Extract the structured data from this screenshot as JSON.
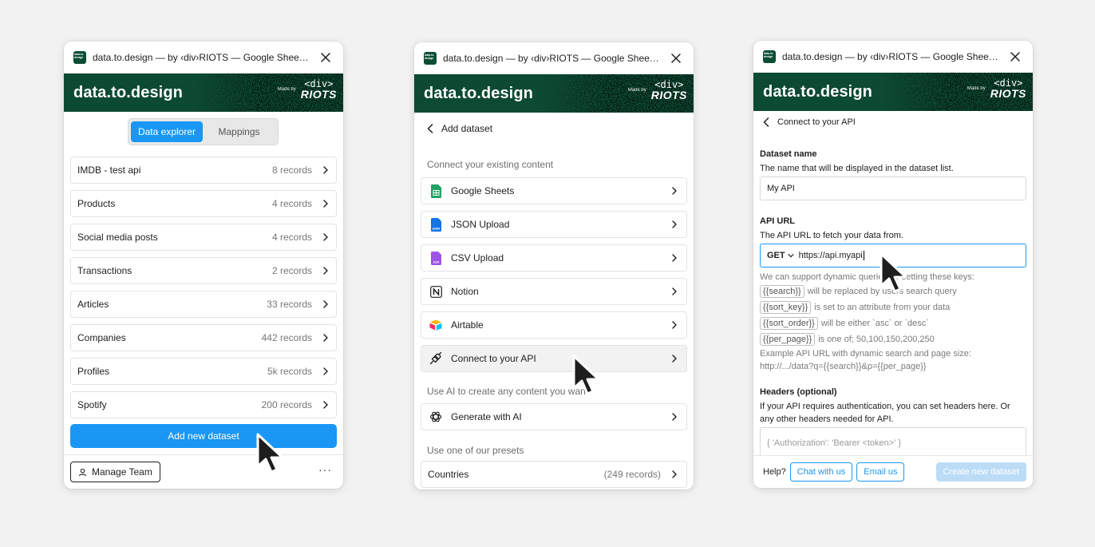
{
  "window_title": "data.to.design — by ‹div›RIOTS — Google Sheets, ...",
  "app_icon_text": "data to design",
  "brand": "data.to.design",
  "made_by_label": "Made by",
  "made_by_div": "<div>",
  "made_by_name": "RIOTS",
  "explorer": {
    "tabs": [
      "Data explorer",
      "Mappings"
    ],
    "datasets": [
      {
        "name": "IMDB - test api",
        "count": "8 records"
      },
      {
        "name": "Products",
        "count": "4 records"
      },
      {
        "name": "Social media posts",
        "count": "4 records"
      },
      {
        "name": "Transactions",
        "count": "2 records"
      },
      {
        "name": "Articles",
        "count": "33 records"
      },
      {
        "name": "Companies",
        "count": "442 records"
      },
      {
        "name": "Profiles",
        "count": "5k records"
      },
      {
        "name": "Spotify",
        "count": "200 records"
      }
    ],
    "add_button": "Add new dataset",
    "manage_team": "Manage Team",
    "more": "···"
  },
  "add_dataset": {
    "title": "Add dataset",
    "existing_label": "Connect your existing content",
    "sources": [
      {
        "name": "Google Sheets",
        "icon": "google-sheets-icon"
      },
      {
        "name": "JSON Upload",
        "icon": "json-file-icon"
      },
      {
        "name": "CSV Upload",
        "icon": "csv-file-icon"
      },
      {
        "name": "Notion",
        "icon": "notion-icon"
      },
      {
        "name": "Airtable",
        "icon": "airtable-icon"
      },
      {
        "name": "Connect to your API",
        "icon": "api-plug-icon"
      }
    ],
    "ai_label": "Use AI to create any content you want",
    "ai_source": "Generate with AI",
    "presets_label": "Use one of our presets",
    "preset": {
      "name": "Countries",
      "count": "(249 records)"
    }
  },
  "api_form": {
    "title": "Connect to your API",
    "name_label": "Dataset name",
    "name_desc": "The name that will be displayed in the dataset list.",
    "name_value": "My API",
    "url_label": "API URL",
    "url_desc": "The API URL to fetch your data from.",
    "method": "GET",
    "url_value": "https://api.myapi",
    "dynamic_intro": "We can support dynamic queries by setting these keys:",
    "keys": [
      {
        "key": "{{search}}",
        "text": "will be replaced by users search query"
      },
      {
        "key": "{{sort_key}}",
        "text": "is set to an attribute from your data"
      },
      {
        "key": "{{sort_order}}",
        "text": "will be either `asc` or `desc`"
      },
      {
        "key": "{{per_page}}",
        "text": "is one of; 50,100,150,200,250"
      }
    ],
    "example_label": "Example API URL with dynamic search and page size:",
    "example_url": "http://.../data?q={{search}}&p={{per_page}}",
    "headers_label": "Headers (optional)",
    "headers_desc": "If your API requires authentication, you can set headers here. Or any other headers needed for API.",
    "headers_placeholder": "{ 'Authorization': 'Bearer <token>' }",
    "help": "Help?",
    "chat": "Chat with us",
    "email": "Email us",
    "create": "Create new dataset"
  },
  "colors": {
    "brand_green": "#0d4a33",
    "accent_blue": "#1a97f5"
  }
}
